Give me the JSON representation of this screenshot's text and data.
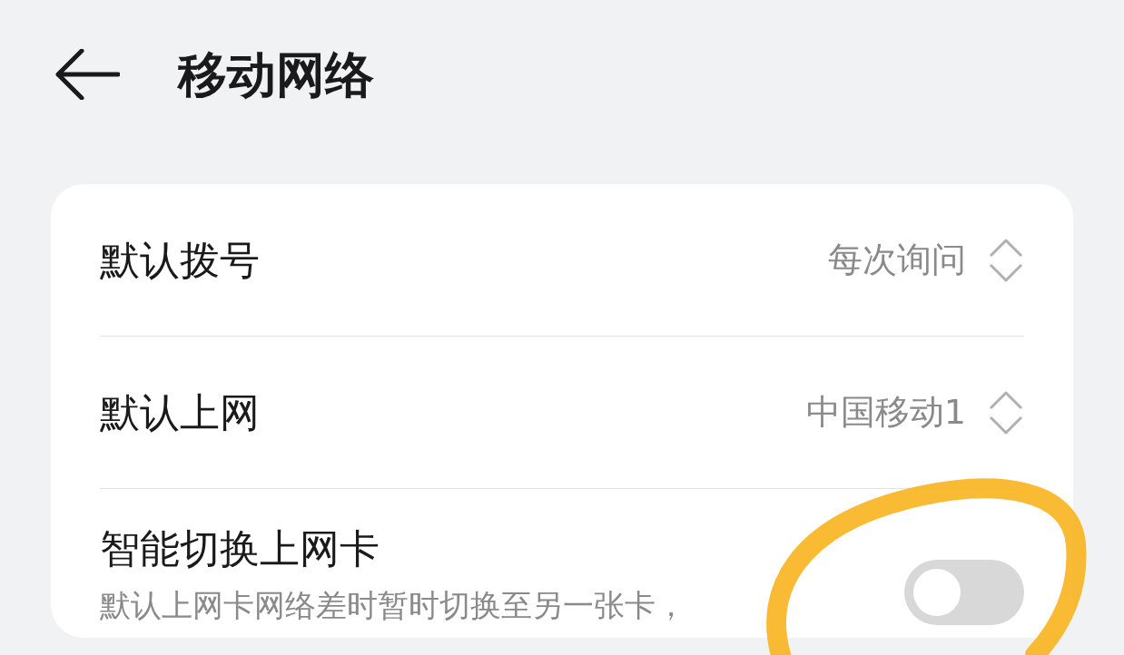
{
  "header": {
    "title": "移动网络"
  },
  "rows": [
    {
      "kind": "select",
      "label": "默认拨号",
      "value": "每次询问"
    },
    {
      "kind": "select",
      "label": "默认上网",
      "value": "中国移动1"
    },
    {
      "kind": "toggle",
      "label": "智能切换上网卡",
      "description": "默认上网卡网络差时暂时切换至另一张卡，",
      "on": false
    }
  ]
}
